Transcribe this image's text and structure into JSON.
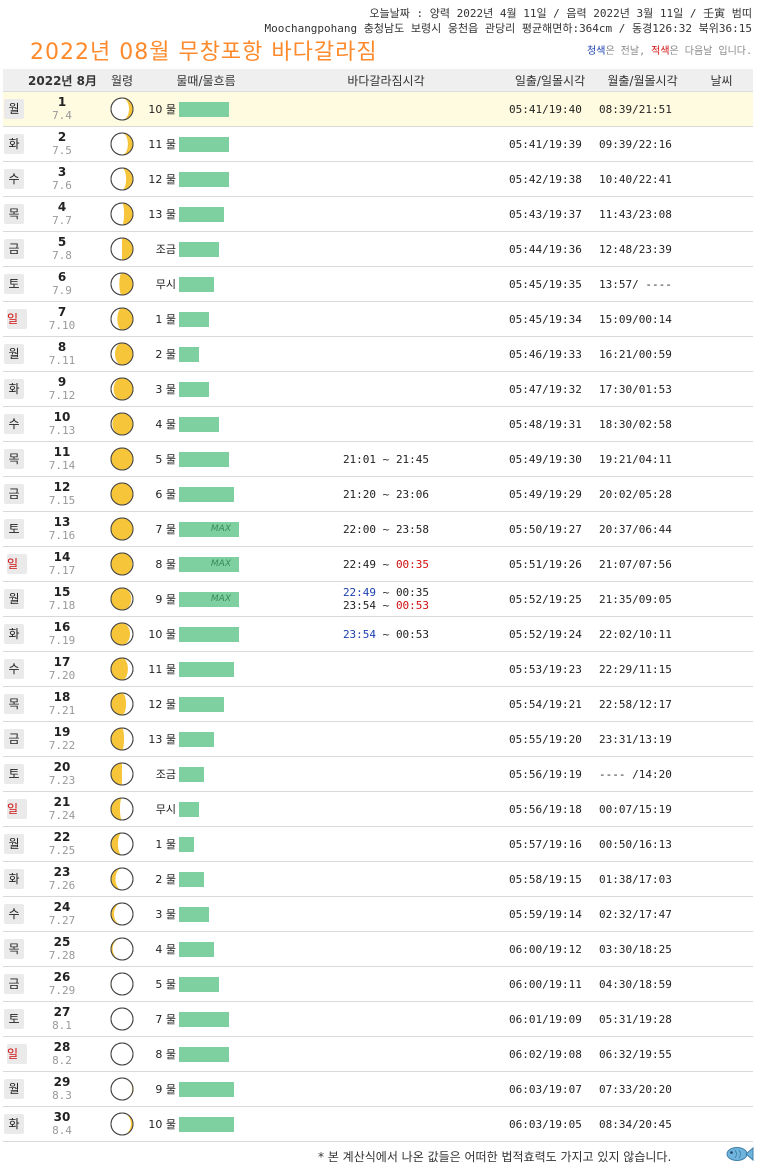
{
  "header": {
    "line1": "오늘날짜 : 양력 2022년 4월 11일 / 음력 2022년 3월 11일 / 壬寅 범띠",
    "line2": "Moochangpohang 충청남도 보령시 웅천읍 관당리 평균해면하:364cm / 동경126:32 북위36:15",
    "title": "2022년 08월 무창포항 바다갈라짐",
    "legend_blue": "청색",
    "legend_mid": "은 전날, ",
    "legend_red": "적색",
    "legend_end": "은 다음날 입니다."
  },
  "table_header": {
    "year_month": "2022년 8月",
    "moon_age": "월령",
    "tide": "물때/물흐름",
    "parting": "바다갈라짐시각",
    "sun": "일출/일몰시각",
    "moon": "월출/월몰시각",
    "weather": "날씨"
  },
  "colors": {
    "title": "#ff8a2b",
    "bar": "#7ed0a0",
    "prev_day": "#1b3fae",
    "next_day": "#d01010",
    "today_row": "#fffbe0"
  },
  "rows": [
    {
      "dow": "월",
      "day": "1",
      "lunar": "7.4",
      "tide": "10 물",
      "flow": 5,
      "parting": [],
      "sun": "05:41/19:40",
      "moon": "08:39/21:51",
      "phase": 0.14
    },
    {
      "dow": "화",
      "day": "2",
      "lunar": "7.5",
      "tide": "11 물",
      "flow": 5,
      "parting": [],
      "sun": "05:41/19:39",
      "moon": "09:39/22:16",
      "phase": 0.16
    },
    {
      "dow": "수",
      "day": "3",
      "lunar": "7.6",
      "tide": "12 물",
      "flow": 5,
      "parting": [],
      "sun": "05:42/19:38",
      "moon": "10:40/22:41",
      "phase": 0.19
    },
    {
      "dow": "목",
      "day": "4",
      "lunar": "7.7",
      "tide": "13 물",
      "flow": 4.5,
      "parting": [],
      "sun": "05:43/19:37",
      "moon": "11:43/23:08",
      "phase": 0.22
    },
    {
      "dow": "금",
      "day": "5",
      "lunar": "7.8",
      "tide": "조금",
      "flow": 4,
      "parting": [],
      "sun": "05:44/19:36",
      "moon": "12:48/23:39",
      "phase": 0.25
    },
    {
      "dow": "토",
      "day": "6",
      "lunar": "7.9",
      "tide": "무시",
      "flow": 3.5,
      "parting": [],
      "sun": "05:45/19:35",
      "moon": "13:57/ ----",
      "phase": 0.29
    },
    {
      "dow": "일",
      "day": "7",
      "lunar": "7.10",
      "tide": "1 물",
      "flow": 3,
      "parting": [],
      "sun": "05:45/19:34",
      "moon": "15:09/00:14",
      "phase": 0.32
    },
    {
      "dow": "월",
      "day": "8",
      "lunar": "7.11",
      "tide": "2 물",
      "flow": 2,
      "parting": [],
      "sun": "05:46/19:33",
      "moon": "16:21/00:59",
      "phase": 0.36
    },
    {
      "dow": "화",
      "day": "9",
      "lunar": "7.12",
      "tide": "3 물",
      "flow": 3,
      "parting": [],
      "sun": "05:47/19:32",
      "moon": "17:30/01:53",
      "phase": 0.39
    },
    {
      "dow": "수",
      "day": "10",
      "lunar": "7.13",
      "tide": "4 물",
      "flow": 4,
      "parting": [],
      "sun": "05:48/19:31",
      "moon": "18:30/02:58",
      "phase": 0.42
    },
    {
      "dow": "목",
      "day": "11",
      "lunar": "7.14",
      "tide": "5 물",
      "flow": 5,
      "parting": [
        {
          "start": "21:01",
          "sc": "",
          "end": "21:45",
          "ec": ""
        }
      ],
      "sun": "05:49/19:30",
      "moon": "19:21/04:11",
      "phase": 0.46
    },
    {
      "dow": "금",
      "day": "12",
      "lunar": "7.15",
      "tide": "6 물",
      "flow": 5.5,
      "parting": [
        {
          "start": "21:20",
          "sc": "",
          "end": "23:06",
          "ec": ""
        }
      ],
      "sun": "05:49/19:29",
      "moon": "20:02/05:28",
      "phase": 0.49
    },
    {
      "dow": "토",
      "day": "13",
      "lunar": "7.16",
      "tide": "7 물",
      "flow": 6,
      "max": "MAX",
      "parting": [
        {
          "start": "22:00",
          "sc": "",
          "end": "23:58",
          "ec": ""
        }
      ],
      "sun": "05:50/19:27",
      "moon": "20:37/06:44",
      "phase": 0.52
    },
    {
      "dow": "일",
      "day": "14",
      "lunar": "7.17",
      "tide": "8 물",
      "flow": 6,
      "max": "MAX",
      "parting": [
        {
          "start": "22:49",
          "sc": "",
          "end": "00:35",
          "ec": "next"
        }
      ],
      "sun": "05:51/19:26",
      "moon": "21:07/07:56",
      "phase": 0.56
    },
    {
      "dow": "월",
      "day": "15",
      "lunar": "7.18",
      "tide": "9 물",
      "flow": 6,
      "max": "MAX",
      "parting": [
        {
          "start": "22:49",
          "sc": "prev",
          "end": "00:35",
          "ec": ""
        },
        {
          "start": "23:54",
          "sc": "",
          "end": "00:53",
          "ec": "next"
        }
      ],
      "sun": "05:52/19:25",
      "moon": "21:35/09:05",
      "phase": 0.59
    },
    {
      "dow": "화",
      "day": "16",
      "lunar": "7.19",
      "tide": "10 물",
      "flow": 6,
      "parting": [
        {
          "start": "23:54",
          "sc": "prev",
          "end": "00:53",
          "ec": ""
        }
      ],
      "sun": "05:52/19:24",
      "moon": "22:02/10:11",
      "phase": 0.62
    },
    {
      "dow": "수",
      "day": "17",
      "lunar": "7.20",
      "tide": "11 물",
      "flow": 5.5,
      "parting": [],
      "sun": "05:53/19:23",
      "moon": "22:29/11:15",
      "phase": 0.66
    },
    {
      "dow": "목",
      "day": "18",
      "lunar": "7.21",
      "tide": "12 물",
      "flow": 4.5,
      "parting": [],
      "sun": "05:54/19:21",
      "moon": "22:58/12:17",
      "phase": 0.69
    },
    {
      "dow": "금",
      "day": "19",
      "lunar": "7.22",
      "tide": "13 물",
      "flow": 3.5,
      "parting": [],
      "sun": "05:55/19:20",
      "moon": "23:31/13:19",
      "phase": 0.72
    },
    {
      "dow": "토",
      "day": "20",
      "lunar": "7.23",
      "tide": "조금",
      "flow": 2.5,
      "parting": [],
      "sun": "05:56/19:19",
      "moon": "---- /14:20",
      "phase": 0.75
    },
    {
      "dow": "일",
      "day": "21",
      "lunar": "7.24",
      "tide": "무시",
      "flow": 2,
      "parting": [],
      "sun": "05:56/19:18",
      "moon": "00:07/15:19",
      "phase": 0.78
    },
    {
      "dow": "월",
      "day": "22",
      "lunar": "7.25",
      "tide": "1 물",
      "flow": 1.5,
      "parting": [],
      "sun": "05:57/19:16",
      "moon": "00:50/16:13",
      "phase": 0.81
    },
    {
      "dow": "화",
      "day": "23",
      "lunar": "7.26",
      "tide": "2 물",
      "flow": 2.5,
      "parting": [],
      "sun": "05:58/19:15",
      "moon": "01:38/17:03",
      "phase": 0.85
    },
    {
      "dow": "수",
      "day": "24",
      "lunar": "7.27",
      "tide": "3 물",
      "flow": 3,
      "parting": [],
      "sun": "05:59/19:14",
      "moon": "02:32/17:47",
      "phase": 0.88
    },
    {
      "dow": "목",
      "day": "25",
      "lunar": "7.28",
      "tide": "4 물",
      "flow": 3.5,
      "parting": [],
      "sun": "06:00/19:12",
      "moon": "03:30/18:25",
      "phase": 0.91
    },
    {
      "dow": "금",
      "day": "26",
      "lunar": "7.29",
      "tide": "5 물",
      "flow": 4,
      "parting": [],
      "sun": "06:00/19:11",
      "moon": "04:30/18:59",
      "phase": 0.95
    },
    {
      "dow": "토",
      "day": "27",
      "lunar": "8.1",
      "tide": "7 물",
      "flow": 5,
      "parting": [],
      "sun": "06:01/19:09",
      "moon": "05:31/19:28",
      "phase": 0.98
    },
    {
      "dow": "일",
      "day": "28",
      "lunar": "8.2",
      "tide": "8 물",
      "flow": 5,
      "parting": [],
      "sun": "06:02/19:08",
      "moon": "06:32/19:55",
      "phase": 0.03
    },
    {
      "dow": "월",
      "day": "29",
      "lunar": "8.3",
      "tide": "9 물",
      "flow": 5.5,
      "parting": [],
      "sun": "06:03/19:07",
      "moon": "07:33/20:20",
      "phase": 0.06
    },
    {
      "dow": "화",
      "day": "30",
      "lunar": "8.4",
      "tide": "10 물",
      "flow": 5.5,
      "parting": [],
      "sun": "06:03/19:05",
      "moon": "08:34/20:45",
      "phase": 0.1
    }
  ],
  "footnote": "* 본 계산식에서 나온 값들은 어떠한 법적효력도 가지고 있지 않습니다."
}
